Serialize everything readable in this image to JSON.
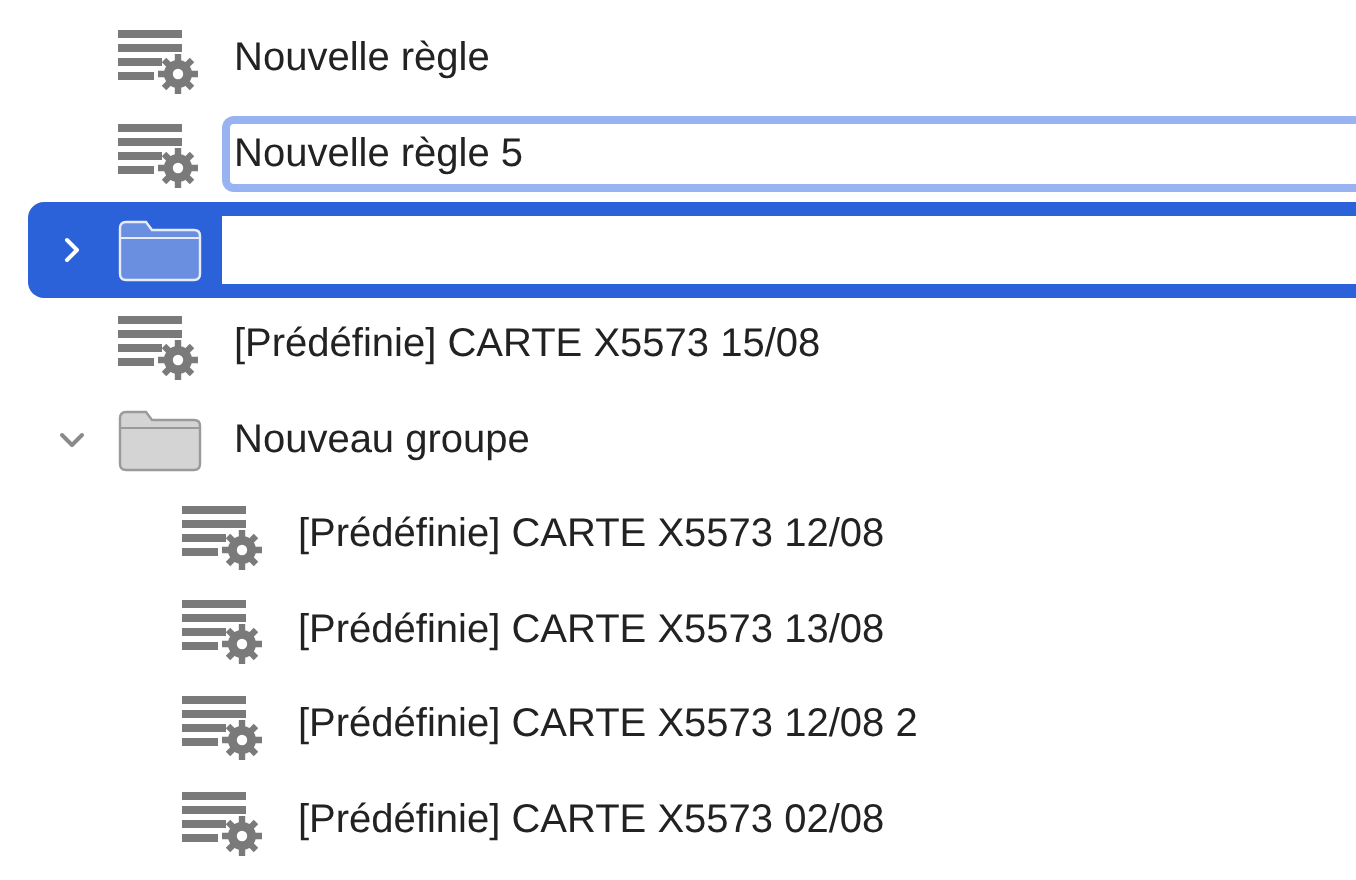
{
  "items": [
    {
      "kind": "rule",
      "label": "Nouvelle règle",
      "selected": false
    },
    {
      "kind": "rule",
      "value": "Nouvelle règle 5",
      "editing": true,
      "focused": true,
      "selected": false
    },
    {
      "kind": "group",
      "editing": true,
      "focused": false,
      "expanded": false,
      "selected": true
    },
    {
      "kind": "rule",
      "label": "[Prédéfinie] CARTE X5573 15/08",
      "selected": false
    },
    {
      "kind": "group",
      "label": "Nouveau groupe",
      "expanded": true,
      "selected": false,
      "children": [
        {
          "kind": "rule",
          "label": "[Prédéfinie] CARTE X5573 12/08",
          "selected": false
        },
        {
          "kind": "rule",
          "label": "[Prédéfinie] CARTE X5573 13/08",
          "selected": false
        },
        {
          "kind": "rule",
          "label": "[Prédéfinie] CARTE X5573 12/08 2",
          "selected": false
        },
        {
          "kind": "rule",
          "label": "[Prédéfinie] CARTE X5573 02/08",
          "selected": false
        }
      ]
    }
  ]
}
